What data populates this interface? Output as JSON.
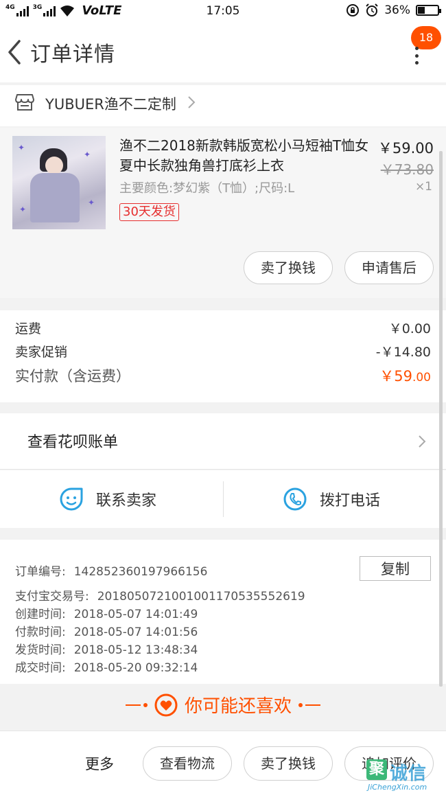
{
  "status_bar": {
    "net_4g": "4G",
    "net_3g": "3G",
    "volte": "VoLTE",
    "time": "17:05",
    "battery_percent": "36%",
    "battery_level": 0.36
  },
  "header": {
    "title": "订单详情",
    "badge_count": "18"
  },
  "shop": {
    "name": "YUBUER渔不二定制"
  },
  "product": {
    "title": "渔不二2018新款韩版宽松小马短袖T恤女夏中长款独角兽打底衫上衣",
    "sku": "主要颜色:梦幻紫（T恤）;尺码:L",
    "delivery_tag": "30天发货",
    "price": "￥59.00",
    "original_price": "￥73.80",
    "quantity": "×1",
    "sell_button": "卖了换钱",
    "after_sale_button": "申请售后"
  },
  "fees": {
    "shipping_label": "运费",
    "shipping_value": "￥0.00",
    "promo_label": "卖家促销",
    "promo_value": "-￥14.80",
    "total_label": "实付款（含运费）",
    "total_value_main": "￥59",
    "total_value_cents": ".00"
  },
  "huabei": {
    "label": "查看花呗账单"
  },
  "contact": {
    "seller_label": "联系卖家",
    "call_label": "拨打电话"
  },
  "order_info": {
    "order_no_label": "订单编号:",
    "order_no": "142852360197966156",
    "copy_button": "复制",
    "alipay_label": "支付宝交易号:",
    "alipay_no": "2018050721001001170535552619",
    "created_label": "创建时间:",
    "created": "2018-05-07  14:01:49",
    "paid_label": "付款时间:",
    "paid": "2018-05-07  14:01:56",
    "shipped_label": "发货时间:",
    "shipped": "2018-05-12  13:48:34",
    "completed_label": "成交时间:",
    "completed": "2018-05-20  09:32:14"
  },
  "recommend": {
    "label": "你可能还喜欢"
  },
  "bottom_bar": {
    "more_label": "更多",
    "logistics_button": "查看物流",
    "sell_button": "卖了换钱",
    "review_button": "追加评价"
  },
  "watermark": {
    "logo_char": "聚",
    "text": "诚信",
    "url": "JiChengXin.com"
  },
  "colors": {
    "accent": "#ff5000",
    "contact_icon": "#2aa2e0",
    "tag_red": "#e62e2e"
  }
}
